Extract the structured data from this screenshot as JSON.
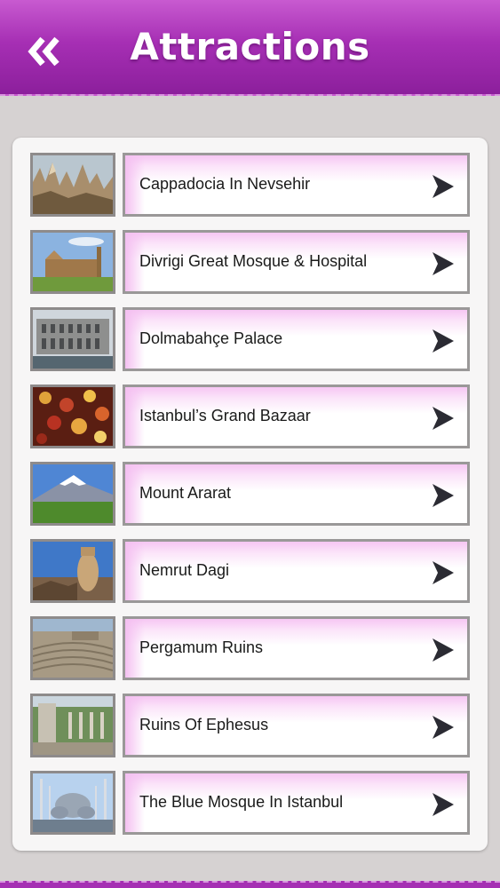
{
  "header": {
    "title": "Attractions",
    "back_icon": "double-chevron-left-icon"
  },
  "colors": {
    "header": "#a62fb4",
    "background": "#d6d2d2",
    "accent_pink": "#f6c6f3"
  },
  "attractions": [
    {
      "label": "Cappadocia In Nevsehir",
      "thumbnail": "cappadocia-photo"
    },
    {
      "label": "Divrigi Great Mosque & Hospital",
      "thumbnail": "divrigi-mosque-photo"
    },
    {
      "label": "Dolmabahçe Palace",
      "thumbnail": "dolmabahce-palace-photo"
    },
    {
      "label": "Istanbul’s Grand Bazaar",
      "thumbnail": "grand-bazaar-photo"
    },
    {
      "label": "Mount Ararat",
      "thumbnail": "mount-ararat-photo"
    },
    {
      "label": "Nemrut Dagi",
      "thumbnail": "nemrut-dagi-photo"
    },
    {
      "label": "Pergamum Ruins",
      "thumbnail": "pergamum-ruins-photo"
    },
    {
      "label": "Ruins Of Ephesus",
      "thumbnail": "ephesus-ruins-photo"
    },
    {
      "label": "The Blue Mosque In Istanbul",
      "thumbnail": "blue-mosque-photo"
    }
  ]
}
